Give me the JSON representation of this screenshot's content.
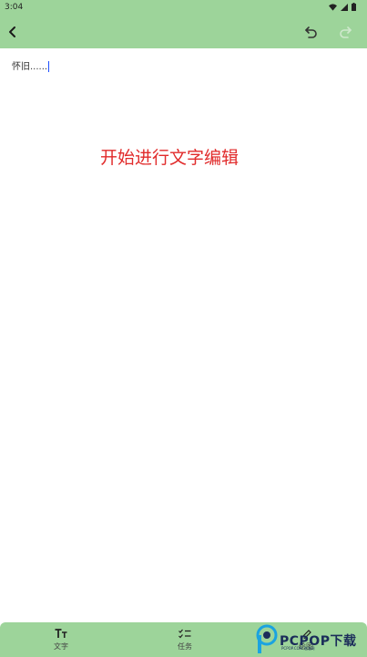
{
  "status_bar": {
    "time": "3:04",
    "icons": [
      "wifi-icon",
      "signal-icon",
      "battery-icon"
    ]
  },
  "toolbar": {
    "back_icon": "chevron-left-icon",
    "undo_icon": "undo-icon",
    "redo_icon": "redo-icon",
    "redo_enabled": false
  },
  "editor": {
    "content": "怀旧......"
  },
  "annotation": {
    "text": "开始进行文字编辑",
    "color": "#e12b2b"
  },
  "bottom_nav": {
    "items": [
      {
        "label": "文字",
        "icon": "text-format-icon"
      },
      {
        "label": "任务",
        "icon": "task-list-icon"
      },
      {
        "label": "绘图",
        "icon": "drawing-icon"
      }
    ]
  },
  "watermark": {
    "brand": "PCPOP下载",
    "tagline": "PCPOP.COM 泡泡网"
  },
  "theme": {
    "bar_color": "#9dd49a",
    "background": "#ffffff"
  }
}
